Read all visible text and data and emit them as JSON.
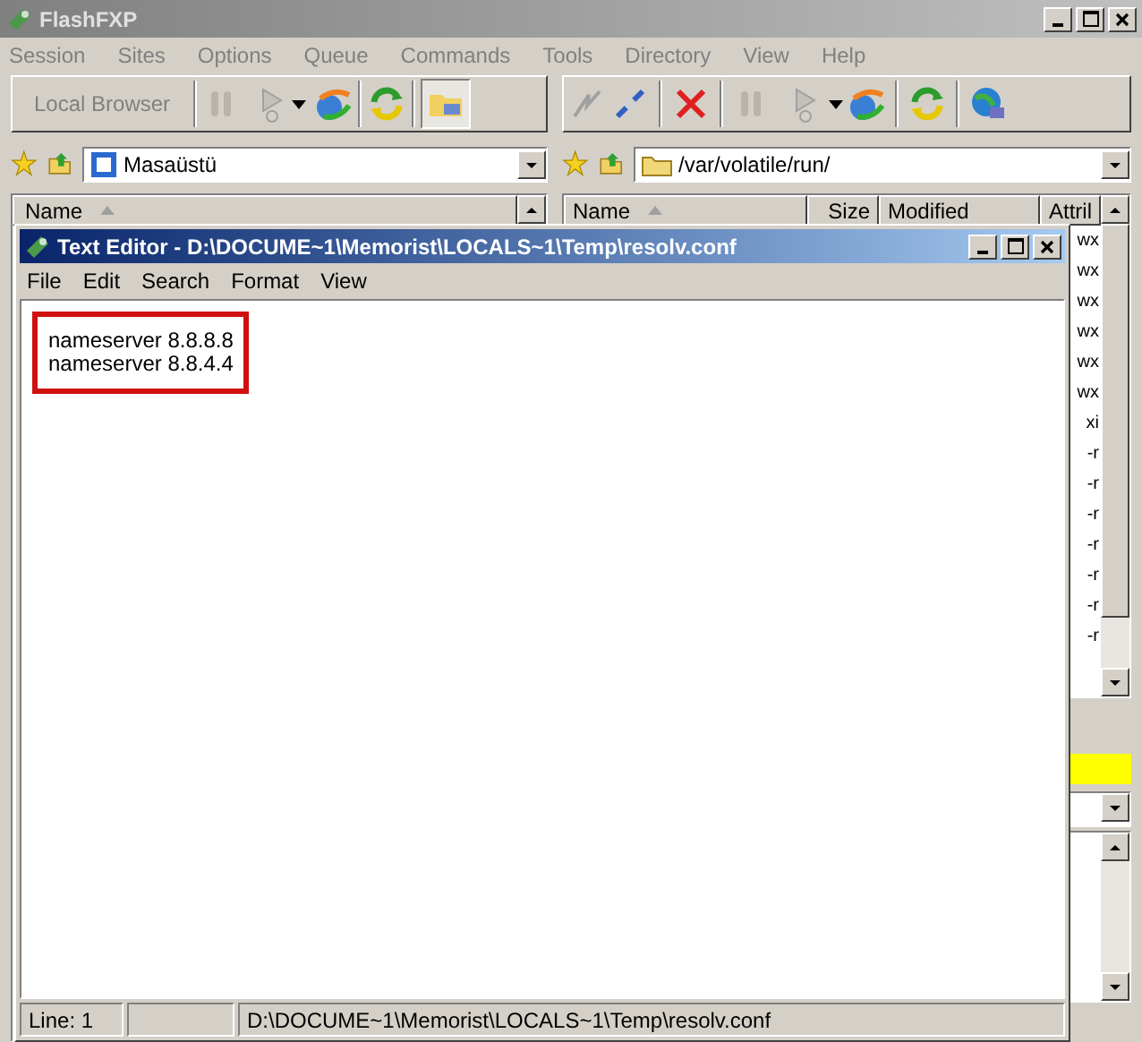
{
  "window": {
    "title": "FlashFXP"
  },
  "menu": [
    "Session",
    "Sites",
    "Options",
    "Queue",
    "Commands",
    "Tools",
    "Directory",
    "View",
    "Help"
  ],
  "left_toolbar": {
    "label": "Local Browser"
  },
  "left_path": "Masaüstü",
  "right_path": "/var/volatile/run/",
  "left_columns": [
    "Name"
  ],
  "right_columns": [
    "Name",
    "Size",
    "Modified",
    "Attril"
  ],
  "right_attr_fragments": [
    "wx",
    "wx",
    "wx",
    "wx",
    "wx",
    "wx",
    "xi",
    "-r",
    "-r",
    "-r",
    "-r",
    "-r",
    "-r",
    "-r"
  ],
  "editor": {
    "title": "Text Editor - D:\\DOCUME~1\\Memorist\\LOCALS~1\\Temp\\resolv.conf",
    "menu": [
      "File",
      "Edit",
      "Search",
      "Format",
      "View"
    ],
    "lines": [
      "nameserver 8.8.8.8",
      "nameserver 8.8.4.4"
    ],
    "status_line": "Line: 1",
    "status_path": "D:\\DOCUME~1\\Memorist\\LOCALS~1\\Temp\\resolv.conf"
  }
}
